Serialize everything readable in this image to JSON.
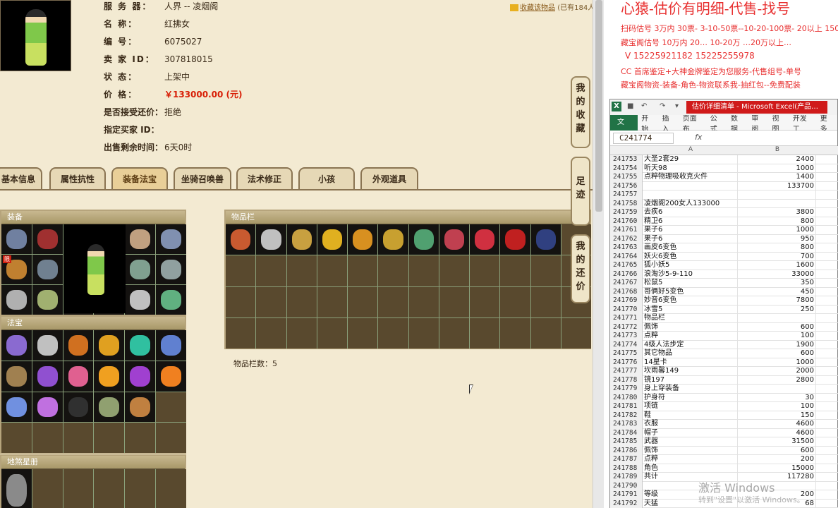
{
  "listing": {
    "server_label": "服 务 器：",
    "server_value": "人界 -- 凌烟阁",
    "name_label": "名 称：",
    "name_value": "红拂女",
    "id_label": "编 号：",
    "id_value": "6075027",
    "seller_label": "卖 家 ID：",
    "seller_value": "307818015",
    "status_label": "状 态：",
    "status_value": "上架中",
    "price_label": "价 格：",
    "price_value": "￥133000.00 (元)",
    "bargain_label": "是否接受还价：",
    "bargain_value": "拒绝",
    "buyer_label": "指定买家 ID：",
    "buyer_value": "",
    "time_label": "出售剩余时间：",
    "time_value": "6天0时",
    "fav_link": "收藏该物品",
    "fav_count": "(已有184人"
  },
  "tabs": [
    "基本信息",
    "属性抗性",
    "装备法宝",
    "坐骑召唤兽",
    "法术修正",
    "小孩",
    "外观道具"
  ],
  "active_tab": "装备法宝",
  "side_tabs": [
    "我的收藏",
    "足迹",
    "我的还价"
  ],
  "panels": {
    "equip": "装备",
    "fabao": "法宝",
    "dish": "地煞星册",
    "bag": "物品栏",
    "bag_count": "物品栏数：5",
    "new_badge": "限"
  },
  "promo": {
    "title": "心猿-估价有明细-代售-找号",
    "line1": "扫码估号 3万内 30票- 3-10-50票--10-20-100票- 20以上 150+",
    "line2": "藏宝阁估号 10万内 20… 10-20万 …20万以上…",
    "line3": "V 15225921182  15225255978",
    "line4": "CC 首席鉴定+大神金牌鉴定为您服务-代售组号-单号",
    "line5": "藏宝阁物资-装备-角色-物资联系我-抽红包--免费配装"
  },
  "excel": {
    "file_title": "估价详细清单 - Microsoft Excel(产品…",
    "ribbon": [
      "文件",
      "开始",
      "插入",
      "页面布",
      "公式",
      "数据",
      "审阅",
      "视图",
      "开发工",
      "更多"
    ],
    "name_box": "C241774",
    "fx": "fx",
    "col_a": "A",
    "col_b": "B",
    "rows": [
      {
        "n": "241753",
        "a": "大圣2套29",
        "b": "2400"
      },
      {
        "n": "241754",
        "a": "听天98",
        "b": "1000"
      },
      {
        "n": "241755",
        "a": "点粹物理吸收克火件",
        "b": "1400"
      },
      {
        "n": "241756",
        "a": "",
        "b": "133700"
      },
      {
        "n": "241757",
        "a": "",
        "b": ""
      },
      {
        "n": "241758",
        "a": "凌烟阁200女人133000",
        "b": ""
      },
      {
        "n": "241759",
        "a": "去疾6",
        "b": "3800"
      },
      {
        "n": "241760",
        "a": "精卫6",
        "b": "800"
      },
      {
        "n": "241761",
        "a": "果子6",
        "b": "1000"
      },
      {
        "n": "241762",
        "a": "果子6",
        "b": "950"
      },
      {
        "n": "241763",
        "a": "画皮6变色",
        "b": "800"
      },
      {
        "n": "241764",
        "a": "妖火6变色",
        "b": "700"
      },
      {
        "n": "241765",
        "a": "狐小妖5",
        "b": "1600"
      },
      {
        "n": "241766",
        "a": "浪淘沙5-9-110",
        "b": "33000"
      },
      {
        "n": "241767",
        "a": "松鼠5",
        "b": "350"
      },
      {
        "n": "241768",
        "a": "哥俩好5变色",
        "b": "450"
      },
      {
        "n": "241769",
        "a": "妙音6变色",
        "b": "7800"
      },
      {
        "n": "241770",
        "a": "冰雪5",
        "b": "250"
      },
      {
        "n": "241771",
        "a": "物品栏",
        "b": ""
      },
      {
        "n": "241772",
        "a": "佩饰",
        "b": "600"
      },
      {
        "n": "241773",
        "a": "点粹",
        "b": "100"
      },
      {
        "n": "241774",
        "a": "4级人法步定",
        "b": "1900"
      },
      {
        "n": "241775",
        "a": "其它物品",
        "b": "600"
      },
      {
        "n": "241776",
        "a": "14星卡",
        "b": "1000"
      },
      {
        "n": "241777",
        "a": "坎雨馨149",
        "b": "2000"
      },
      {
        "n": "241778",
        "a": "镜197",
        "b": "2800"
      },
      {
        "n": "241779",
        "a": "身上穿装备",
        "b": ""
      },
      {
        "n": "241780",
        "a": "护身符",
        "b": "30"
      },
      {
        "n": "241781",
        "a": "项链",
        "b": "100"
      },
      {
        "n": "241782",
        "a": "鞋",
        "b": "150"
      },
      {
        "n": "241783",
        "a": "衣服",
        "b": "4600"
      },
      {
        "n": "241784",
        "a": "帽子",
        "b": "4600"
      },
      {
        "n": "241785",
        "a": "武器",
        "b": "31500"
      },
      {
        "n": "241786",
        "a": "佩饰",
        "b": "600"
      },
      {
        "n": "241787",
        "a": "点粹",
        "b": "200"
      },
      {
        "n": "241788",
        "a": "角色",
        "b": "15000"
      },
      {
        "n": "241789",
        "a": "共计",
        "b": "117280"
      },
      {
        "n": "241790",
        "a": "",
        "b": ""
      },
      {
        "n": "241791",
        "a": "等级",
        "b": "200"
      },
      {
        "n": "241792",
        "a": "天猛",
        "b": "68"
      }
    ]
  },
  "watermark": {
    "line1": "激活 Windows",
    "line2": "转到\"设置\"以激活 Windows。"
  },
  "colors": {
    "accent": "#d81e06",
    "page_bg": "#f3ead2",
    "panel_bg": "#5e5238",
    "excel_green": "#217346"
  },
  "equip_icons": [
    "armor-icon",
    "hat-icon",
    "",
    "",
    "mask-icon",
    "necklace-icon",
    "ring-icon",
    "robe-icon",
    "",
    "",
    "bracelet-icon",
    "ring2-icon",
    "sword-icon",
    "boots-icon",
    "",
    "",
    "bangle-icon",
    "orb-icon"
  ],
  "fabao_icons": [
    "#8a6ad0",
    "#c0c0c0",
    "#d07020",
    "#e0a020",
    "#30c0a0",
    "#6080d0",
    "#a08050",
    "#9050d0",
    "#e06090",
    "#f0a020",
    "#a040d0",
    "#f08020",
    "#7090e0",
    "#c070e0",
    "#303030",
    "#90a070",
    "#c08040",
    ""
  ],
  "bag_icons": [
    "#c85a30",
    "#c0c0c0",
    "#c8a040",
    "#e0b020",
    "#d89020",
    "#c8a030",
    "#50a070",
    "#c04050",
    "#d03040",
    "#c02020",
    "#304080"
  ]
}
